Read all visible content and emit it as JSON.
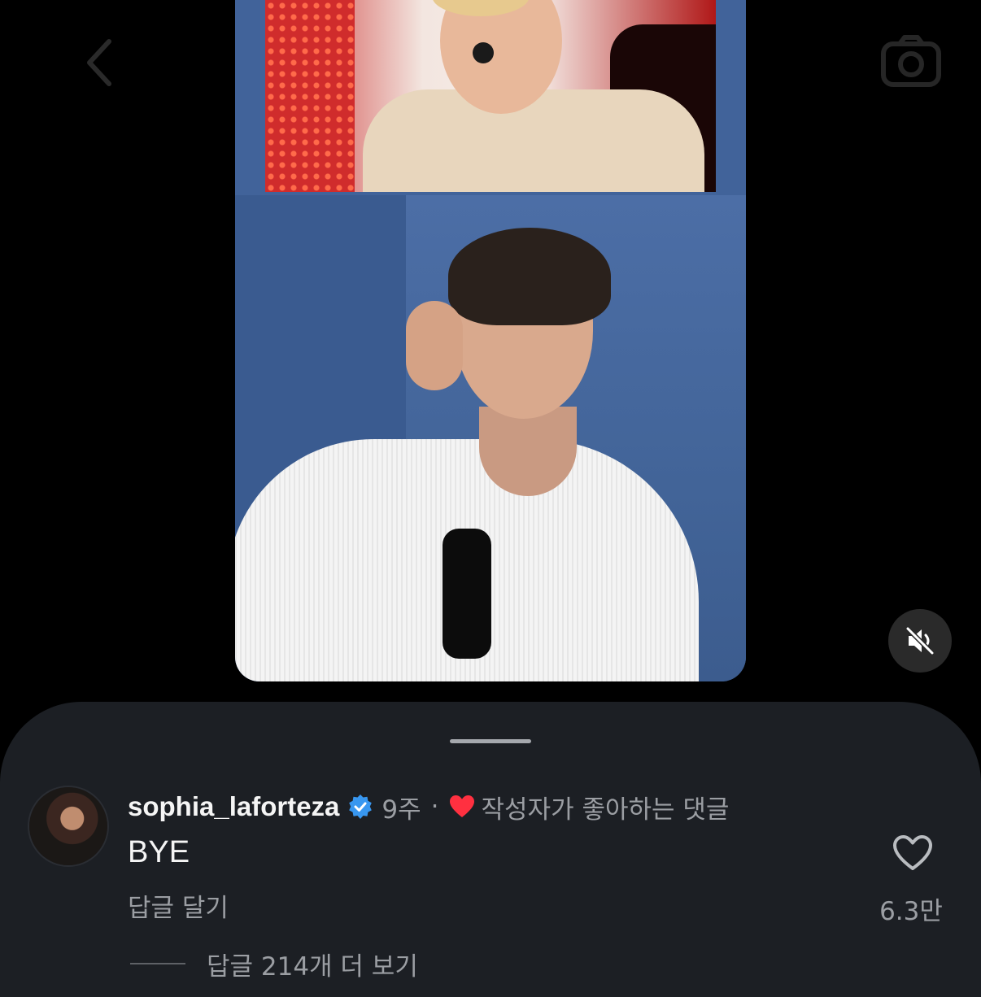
{
  "nav": {
    "back_icon": "chevron-left-icon",
    "camera_icon": "camera-icon"
  },
  "video": {
    "mute_icon": "speaker-muted-icon"
  },
  "comment": {
    "username": "sophia_laforteza",
    "verified_icon": "verified-badge-icon",
    "time": "9주",
    "separator": "·",
    "author_liked_icon": "red-heart-icon",
    "author_liked_label": "작성자가 좋아하는 댓글",
    "text": "BYE",
    "reply_label": "답글 달기",
    "like_icon": "heart-outline-icon",
    "like_count": "6.3만",
    "view_replies_label": "답글 214개 더 보기"
  },
  "colors": {
    "background": "#000000",
    "sheet": "#1c1f24",
    "verified": "#3897f0",
    "liked_heart": "#ff3040",
    "muted_text": "#9b9ea3"
  }
}
